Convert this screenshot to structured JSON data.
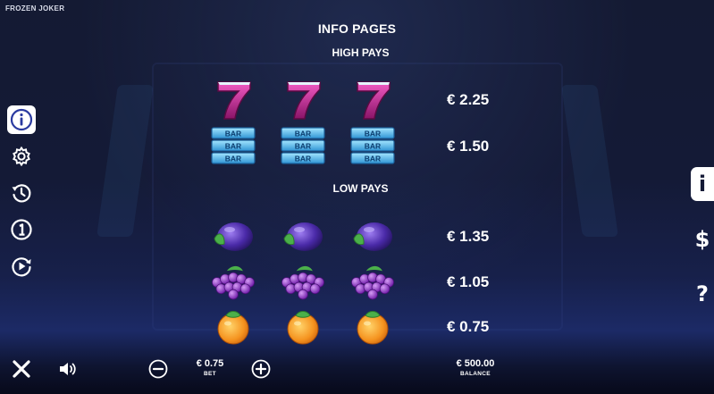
{
  "game": {
    "title": "FROZEN JOKER"
  },
  "panel": {
    "title": "INFO PAGES"
  },
  "sections": {
    "high": "HIGH PAYS",
    "low": "LOW PAYS"
  },
  "paytable": [
    {
      "symbol": "seven-icon",
      "payout": "€ 2.25"
    },
    {
      "symbol": "bar-icon",
      "payout": "€ 1.50"
    },
    {
      "symbol": "plum-icon",
      "payout": "€ 1.35"
    },
    {
      "symbol": "grapes-icon",
      "payout": "€ 1.05"
    },
    {
      "symbol": "orange-icon",
      "payout": "€ 0.75"
    }
  ],
  "symbol_text": {
    "bar": "BAR"
  },
  "right_tabs": {
    "info": "i",
    "paytable": "$",
    "help": "?"
  },
  "left_menu": [
    "info-icon",
    "settings-icon",
    "history-icon",
    "rules-icon",
    "autoplay-icon"
  ],
  "bottom_bar": {
    "bet_amount": "€ 0.75",
    "bet_label": "BET",
    "balance_amount": "€ 500.00",
    "balance_label": "BALANCE"
  },
  "colors": {
    "accent": "#ffffff",
    "background": "#141a36",
    "bar_symbol": "#5fc4ef",
    "seven_symbol": "#c0228e"
  }
}
